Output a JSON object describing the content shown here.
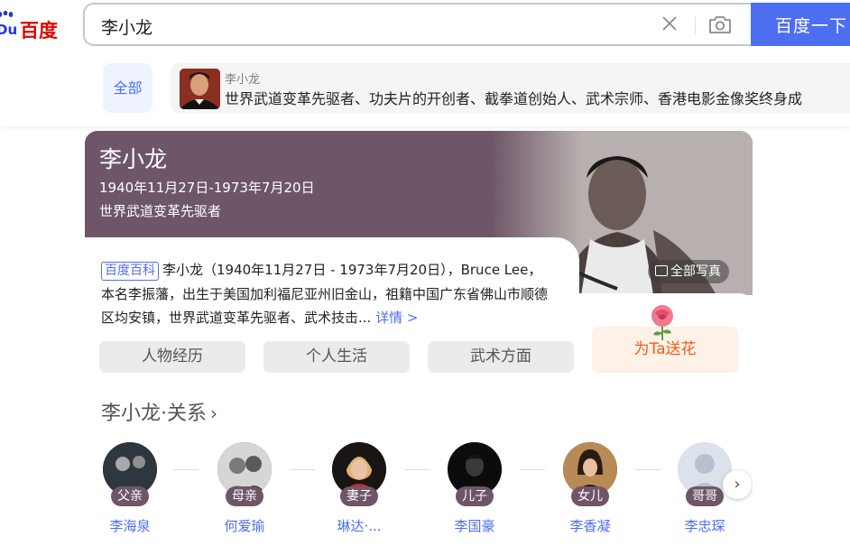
{
  "header": {
    "logo_text": "百度",
    "logo_du": "Du",
    "query": "李小龙",
    "search_button": "百度一下"
  },
  "tabs": {
    "all_label": "全部"
  },
  "suggestion": {
    "name": "李小龙",
    "description": "世界武道变革先驱者、功夫片的开创者、截拳道创始人、武术宗师、香港电影金像奖终身成"
  },
  "card": {
    "title": "李小龙",
    "dates": "1940年11月27日-1973年7月20日",
    "tagline": "世界武道变革先驱者",
    "photos_button": "全部写真",
    "baike_tag": "百度百科",
    "baike_text": "李小龙（1940年11月27日 - 1973年7月20日），Bruce Lee，本名李振藩，出生于美国加利福尼亚州旧金山，祖籍中国广东省佛山市顺德区均安镇，世界武道变革先驱者、武术技击...",
    "baike_more": "详情 >",
    "chips": [
      "人物经历",
      "个人生活",
      "武术方面"
    ],
    "flower_button": "为Ta送花",
    "relations_title": "李小龙·关系",
    "relations_chevron": "›",
    "relations": [
      {
        "role": "父亲",
        "name": "李海泉"
      },
      {
        "role": "母亲",
        "name": "何爱瑜"
      },
      {
        "role": "妻子",
        "name": "琳达·..."
      },
      {
        "role": "儿子",
        "name": "李国豪"
      },
      {
        "role": "女儿",
        "name": "李香凝"
      },
      {
        "role": "哥哥",
        "name": "李忠琛"
      }
    ],
    "next_arrow": "›"
  },
  "colors": {
    "brand_blue": "#4e6ef2",
    "hero_bg": "#6e5668",
    "flower_text": "#f35b1b"
  }
}
